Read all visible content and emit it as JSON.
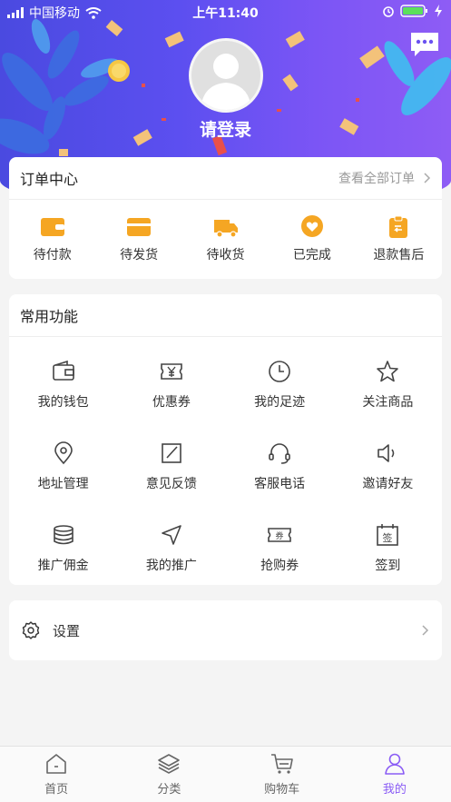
{
  "status_bar": {
    "carrier": "中国移动",
    "time": "上午11:40"
  },
  "header": {
    "login_text": "请登录",
    "message_icon": "chat-bubble-icon"
  },
  "order_center": {
    "title": "订单中心",
    "view_all": "查看全部订单",
    "accent_color": "#f5a623",
    "items": [
      {
        "label": "待付款",
        "icon": "wallet-icon"
      },
      {
        "label": "待发货",
        "icon": "box-icon"
      },
      {
        "label": "待收货",
        "icon": "truck-icon"
      },
      {
        "label": "已完成",
        "icon": "heart-badge-icon"
      },
      {
        "label": "退款售后",
        "icon": "refund-clipboard-icon"
      }
    ]
  },
  "common_functions": {
    "title": "常用功能",
    "items": [
      {
        "label": "我的钱包",
        "icon": "wallet-outline-icon"
      },
      {
        "label": "优惠券",
        "icon": "coupon-yen-icon"
      },
      {
        "label": "我的足迹",
        "icon": "clock-icon"
      },
      {
        "label": "关注商品",
        "icon": "star-icon"
      },
      {
        "label": "地址管理",
        "icon": "location-pin-icon"
      },
      {
        "label": "意见反馈",
        "icon": "edit-icon"
      },
      {
        "label": "客服电话",
        "icon": "headset-icon"
      },
      {
        "label": "邀请好友",
        "icon": "speaker-icon"
      },
      {
        "label": "推广佣金",
        "icon": "coins-stack-icon"
      },
      {
        "label": "我的推广",
        "icon": "navigation-arrow-icon"
      },
      {
        "label": "抢购券",
        "icon": "ticket-icon"
      },
      {
        "label": "签到",
        "icon": "calendar-sign-icon"
      }
    ],
    "ticket_glyph": "券",
    "sign_glyph": "签"
  },
  "settings": {
    "label": "设置"
  },
  "tabbar": {
    "active_color": "#8a5cf5",
    "items": [
      {
        "label": "首页",
        "icon": "home-icon"
      },
      {
        "label": "分类",
        "icon": "layers-icon"
      },
      {
        "label": "购物车",
        "icon": "cart-icon"
      },
      {
        "label": "我的",
        "icon": "user-icon"
      }
    ]
  }
}
